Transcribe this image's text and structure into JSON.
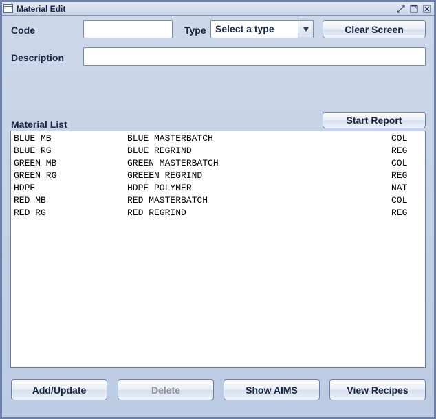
{
  "window": {
    "title": "Material Edit"
  },
  "form": {
    "code_label": "Code",
    "code_value": "",
    "type_label": "Type",
    "type_selected": "Select a type",
    "description_label": "Description",
    "description_value": "",
    "clear_button": "Clear Screen"
  },
  "list": {
    "heading": "Material List",
    "start_report_button": "Start Report",
    "rows": [
      {
        "code": "BLUE MB",
        "desc": "BLUE MASTERBATCH",
        "type": "COL"
      },
      {
        "code": "BLUE RG",
        "desc": "BLUE REGRIND",
        "type": "REG"
      },
      {
        "code": "GREEN MB",
        "desc": "GREEN MASTERBATCH",
        "type": "COL"
      },
      {
        "code": "GREEN RG",
        "desc": "GREEEN REGRIND",
        "type": "REG"
      },
      {
        "code": "HDPE",
        "desc": "HDPE POLYMER",
        "type": "NAT"
      },
      {
        "code": "RED MB",
        "desc": "RED MASTERBATCH",
        "type": "COL"
      },
      {
        "code": "RED RG",
        "desc": "RED REGRIND",
        "type": "REG"
      }
    ]
  },
  "footer": {
    "add_update": "Add/Update",
    "delete": "Delete",
    "show_aims": "Show AIMS",
    "view_recipes": "View Recipes"
  }
}
